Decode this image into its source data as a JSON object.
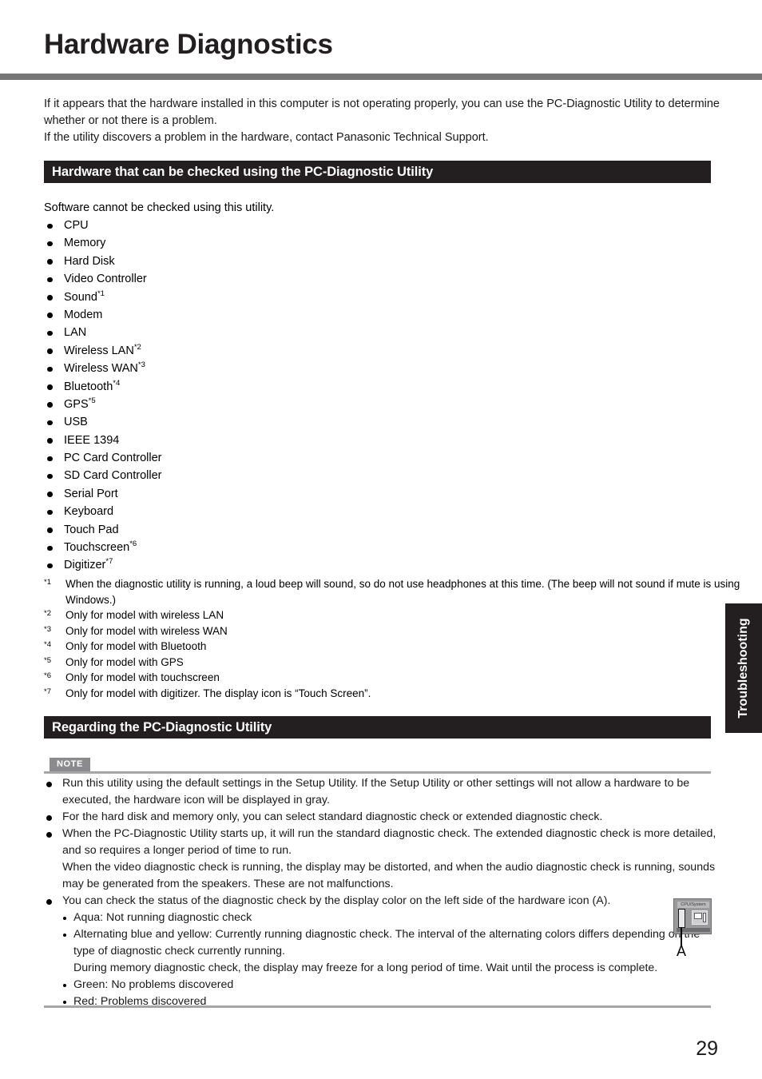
{
  "page": {
    "title": "Hardware Diagnostics",
    "number": "29",
    "side_tab": "Troubleshooting"
  },
  "intro": "If it appears that the hardware installed in this computer is not operating properly, you can use the PC-Diagnostic Utility to determine whether or not there is a problem.\nIf the utility discovers a problem in the hardware, contact Panasonic Technical Support.",
  "sections": {
    "hardware_checked": {
      "heading": "Hardware that can be checked using the PC-Diagnostic Utility",
      "lead": "Software cannot be checked using this utility.",
      "items": [
        {
          "label": "CPU",
          "fn": ""
        },
        {
          "label": "Memory",
          "fn": ""
        },
        {
          "label": "Hard Disk",
          "fn": ""
        },
        {
          "label": "Video Controller",
          "fn": ""
        },
        {
          "label": "Sound",
          "fn": "*1"
        },
        {
          "label": "Modem",
          "fn": ""
        },
        {
          "label": "LAN",
          "fn": ""
        },
        {
          "label": "Wireless LAN",
          "fn": "*2"
        },
        {
          "label": "Wireless WAN",
          "fn": "*3"
        },
        {
          "label": "Bluetooth",
          "fn": "*4"
        },
        {
          "label": "GPS",
          "fn": "*5"
        },
        {
          "label": "USB",
          "fn": ""
        },
        {
          "label": "IEEE 1394",
          "fn": ""
        },
        {
          "label": "PC Card Controller",
          "fn": ""
        },
        {
          "label": "SD Card Controller",
          "fn": ""
        },
        {
          "label": "Serial Port",
          "fn": ""
        },
        {
          "label": "Keyboard",
          "fn": ""
        },
        {
          "label": "Touch Pad",
          "fn": ""
        },
        {
          "label": "Touchscreen",
          "fn": "*6"
        },
        {
          "label": "Digitizer",
          "fn": "*7"
        }
      ],
      "footnotes": [
        {
          "marker": "*1",
          "text": "When the diagnostic utility is running, a loud beep will sound, so do not use headphones at this time. (The beep will not sound if mute is using Windows.)"
        },
        {
          "marker": "*2",
          "text": "Only for model with wireless LAN"
        },
        {
          "marker": "*3",
          "text": "Only for model with wireless WAN"
        },
        {
          "marker": "*4",
          "text": "Only for model with Bluetooth"
        },
        {
          "marker": "*5",
          "text": "Only for model with GPS"
        },
        {
          "marker": "*6",
          "text": "Only for model with touchscreen"
        },
        {
          "marker": "*7",
          "text": "Only for model with digitizer. The display icon is “Touch Screen”."
        }
      ]
    },
    "regarding_utility": {
      "heading": "Regarding the PC-Diagnostic Utility",
      "note_badge": "NOTE",
      "notes": [
        {
          "text": "Run this utility using the default settings in the Setup Utility. If the Setup Utility or other settings will not allow a hardware to be executed, the hardware icon will be displayed in gray."
        },
        {
          "text": "For the hard disk and memory only, you can select standard diagnostic check or extended diagnostic check."
        },
        {
          "text": "When the PC-Diagnostic Utility starts up, it will run the standard diagnostic check. The extended diagnostic check is more detailed, and so requires a longer period of time to run.",
          "continuation": "When the video diagnostic check is running, the display may be distorted, and when the audio diagnostic check is running, sounds may be generated from the speakers. These are not malfunctions."
        },
        {
          "text": "You can check the status of the diagnostic check by the display color on the left side of the hardware icon (A)."
        }
      ],
      "status_colors": [
        {
          "text": "Aqua: Not running diagnostic check"
        },
        {
          "text": "Alternating blue and yellow: Currently running diagnostic check. The interval of the alternating colors differs depending on the type of diagnostic check currently running.",
          "continuation": "During memory diagnostic check, the display may freeze for a long period of time. Wait until the process is complete."
        },
        {
          "text": "Green: No problems discovered"
        },
        {
          "text": "Red: Problems discovered"
        }
      ]
    }
  },
  "figure": {
    "callout": "A",
    "icon_title": "CPU/System"
  },
  "colors": {
    "rule_gray": "#77777a",
    "bar_black": "#231f20",
    "note_gray": "#8b8b8e"
  }
}
